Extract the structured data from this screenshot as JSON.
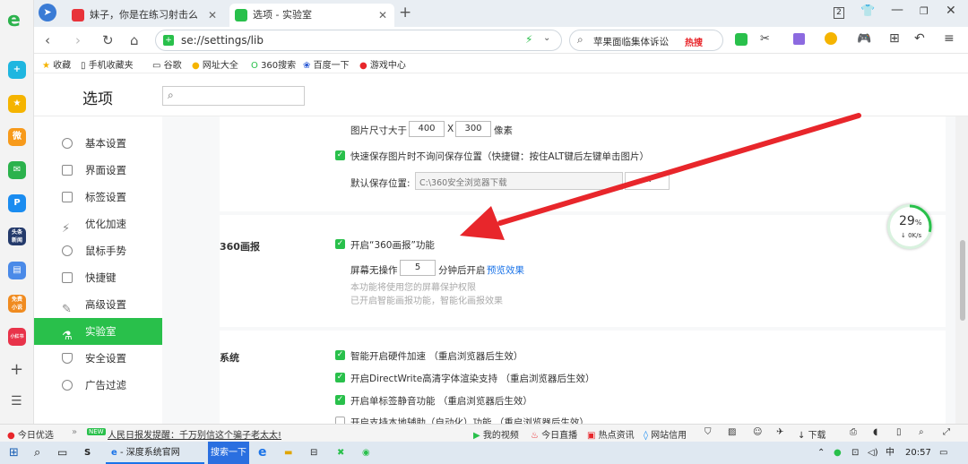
{
  "left_bar": {
    "icons": [
      "browser-logo-icon",
      "add-app-icon",
      "favorites-star-icon",
      "weibo-icon",
      "mail-icon",
      "p-app-icon",
      "news-app-icon",
      "doc-app-icon",
      "novel-app-icon",
      "store-app-icon",
      "add-icon",
      "menu-icon"
    ],
    "labels": {
      "news": "头条\n新闻",
      "novel": "免费\n小说",
      "store": "小红书"
    }
  },
  "tabs": [
    {
      "title": "妹子，你是在练习射击么。枪法",
      "active": false
    },
    {
      "title": "选项 - 实验室",
      "active": true
    }
  ],
  "window_controls": {
    "badge": "2"
  },
  "address": {
    "url": "se://settings/lib",
    "search_text": "苹果面临集体诉讼",
    "hot_label": "热搜"
  },
  "bookmarks": [
    "收藏",
    "手机收藏夹",
    "谷歌",
    "网址大全",
    "360搜索",
    "百度一下",
    "游戏中心"
  ],
  "page": {
    "title": "选项",
    "search_placeholder": ""
  },
  "sidebar": [
    {
      "label": "基本设置",
      "icon": "basic-settings-icon"
    },
    {
      "label": "界面设置",
      "icon": "interface-icon"
    },
    {
      "label": "标签设置",
      "icon": "tab-settings-icon"
    },
    {
      "label": "优化加速",
      "icon": "speed-icon"
    },
    {
      "label": "鼠标手势",
      "icon": "mouse-icon"
    },
    {
      "label": "快捷键",
      "icon": "keyboard-icon"
    },
    {
      "label": "高级设置",
      "icon": "advanced-icon"
    },
    {
      "label": "实验室",
      "icon": "lab-icon",
      "active": true
    },
    {
      "label": "安全设置",
      "icon": "shield-icon"
    },
    {
      "label": "广告过滤",
      "icon": "block-icon"
    }
  ],
  "image_section": {
    "size_label": "图片尺寸大于",
    "width": "400",
    "x_sep": "X",
    "height": "300",
    "unit": "像素",
    "quick_save": "快速保存图片时不询问保存位置（快捷键：按住ALT键后左键单击图片）",
    "save_location_label": "默认保存位置:",
    "save_location_value": "C:\\360安全浏览器下载",
    "browse_button": "..."
  },
  "screensaver": {
    "heading": "360画报",
    "enable_label": "开启“360画报”功能",
    "idle_label": "屏幕无操作",
    "minutes": "5",
    "after_label": "分钟后开启",
    "preview_link": "预览效果",
    "note1": "本功能将使用您的屏幕保护权限",
    "note2": "已开启智能画报功能，智能化画报效果"
  },
  "system": {
    "heading": "系统",
    "options": [
      {
        "label": "智能开启硬件加速 （重启浏览器后生效）",
        "checked": true
      },
      {
        "label": "开启DirectWrite高清字体渲染支持 （重启浏览器后生效）",
        "checked": true
      },
      {
        "label": "开启单标签静音功能 （重启浏览器后生效）",
        "checked": true
      },
      {
        "label": "开启支持本地辅助（自动化）功能 （重启浏览器后生效）",
        "checked": false
      }
    ]
  },
  "speed_widget": {
    "percent": "29",
    "rate": "0K/s"
  },
  "status_bar": {
    "today": "今日优选",
    "new_badge": "NEW",
    "headline": "人民日报发提醒：千万别信这个骗子老太太!",
    "items": [
      "我的视频",
      "今日直播",
      "热点资讯",
      "网站信用"
    ],
    "download": "下载"
  },
  "taskbar": {
    "app1": "深度系统官网",
    "app2": "搜索一下",
    "ime": "中",
    "time": "20:57"
  },
  "colors": {
    "accent": "#29c04b",
    "arrow": "#e8262b",
    "link": "#1a73e8"
  }
}
